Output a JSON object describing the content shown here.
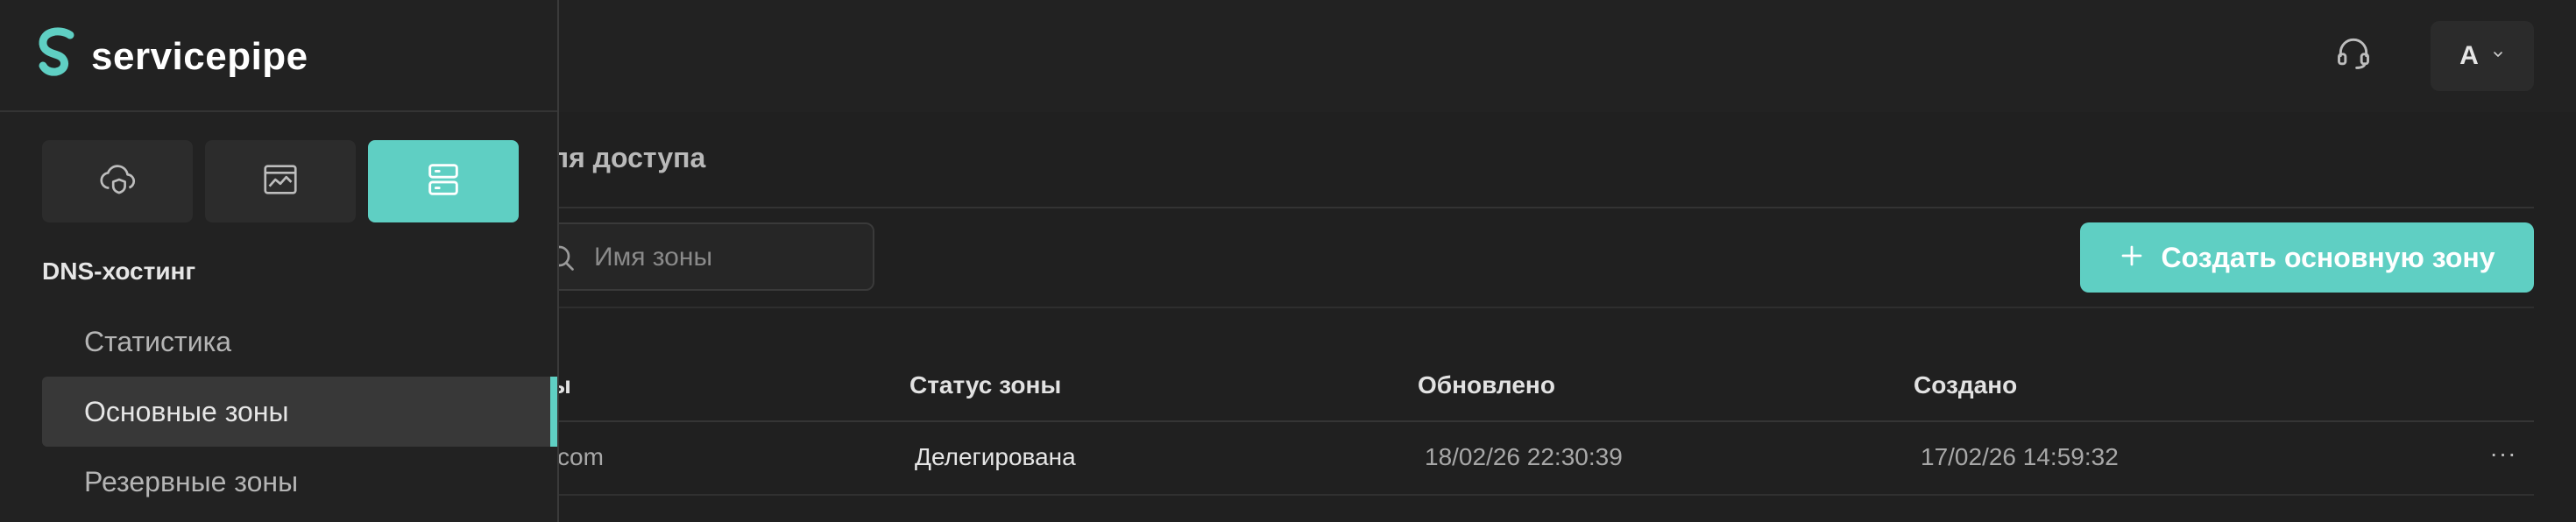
{
  "brand": {
    "name": "servicepipe",
    "accent": "#5fcfc3"
  },
  "header": {
    "support_icon": "headset-icon",
    "user_initial": "A",
    "user_menu_icon": "chevron-down-icon"
  },
  "sidebar": {
    "services": [
      {
        "icon": "cloud-shield-icon",
        "active": false
      },
      {
        "icon": "browser-chart-icon",
        "active": false
      },
      {
        "icon": "server-stack-icon",
        "active": true
      }
    ],
    "section_title": "DNS-хостинг",
    "items": [
      {
        "label": "Статистика",
        "active": false
      },
      {
        "label": "Основные зоны",
        "active": true
      },
      {
        "label": "Резервные зоны",
        "active": false
      }
    ]
  },
  "main": {
    "tab_label": "оля доступа",
    "search": {
      "placeholder": "Имя зоны",
      "value": ""
    },
    "create_button": {
      "label": "Создать основную зону",
      "icon": "plus-icon"
    },
    "table": {
      "columns": [
        "ы",
        "Статус зоны",
        "Обновлено",
        "Создано"
      ],
      "rows": [
        {
          "name": "com",
          "status": "Делегирована",
          "updated": "18/02/26 22:30:39",
          "created": "17/02/26 14:59:32",
          "menu": "···"
        }
      ]
    }
  }
}
